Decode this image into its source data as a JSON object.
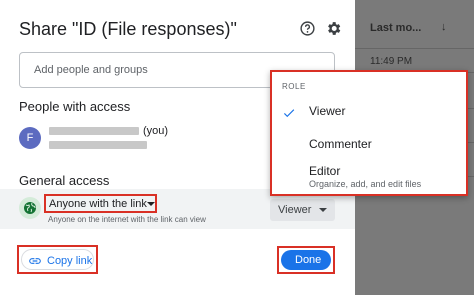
{
  "dialog": {
    "title": "Share \"ID (File responses)\"",
    "add_placeholder": "Add people and groups",
    "people_heading": "People with access",
    "owner": {
      "avatar_letter": "F",
      "you_label": "(you)"
    },
    "general_heading": "General access",
    "link_access": "Anyone with the link",
    "link_description": "Anyone on the internet with the link can view",
    "role_button": "Viewer",
    "copy_link": "Copy link",
    "done": "Done"
  },
  "role_menu": {
    "heading": "ROLE",
    "items": [
      {
        "label": "Viewer",
        "selected": true
      },
      {
        "label": "Commenter"
      },
      {
        "label": "Editor",
        "description": "Organize, add, and edit files"
      }
    ]
  },
  "background": {
    "column_header": "Last mo...",
    "cell_time": "11:49 PM",
    "cell_sub": "PM"
  },
  "colors": {
    "accent": "#1a73e8",
    "highlight": "#d93025",
    "avatar": "#5c6bc0"
  }
}
